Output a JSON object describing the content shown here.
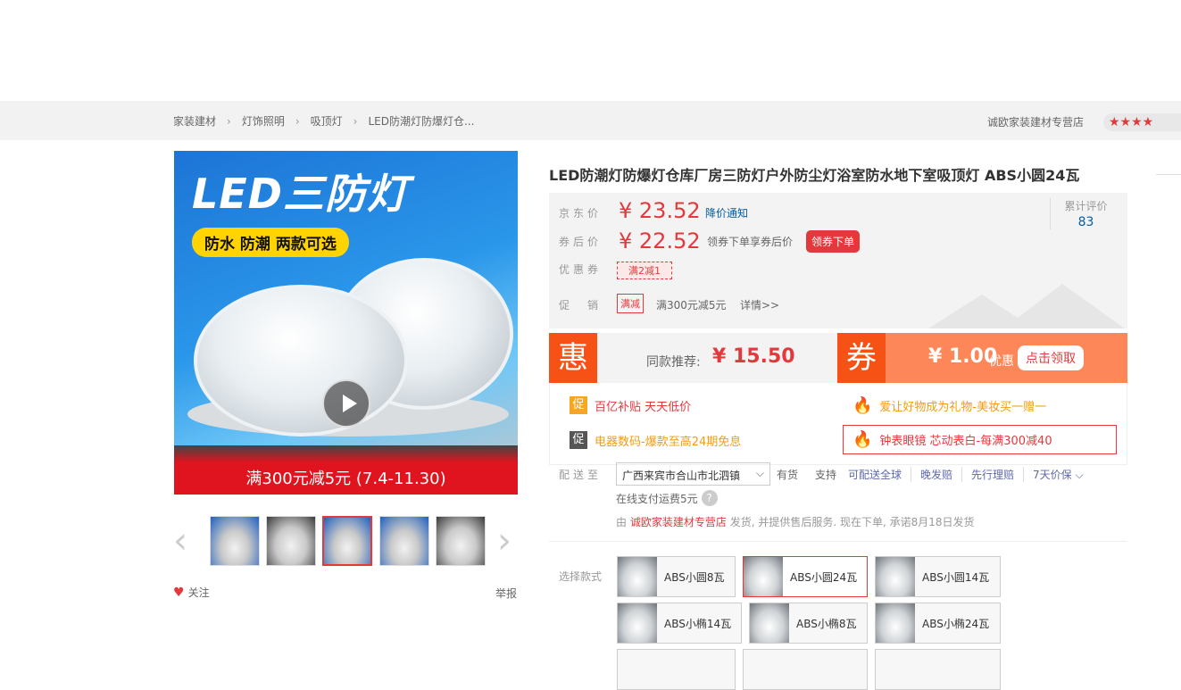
{
  "breadcrumb": [
    "家装建材",
    "灯饰照明",
    "吸顶灯",
    "LED防潮灯防爆灯仓..."
  ],
  "breadcrumb_sep": "›",
  "shop": {
    "name": "诚欧家装建材专营店",
    "stars": "★★★★"
  },
  "gallery": {
    "main_title": "LED三防灯",
    "main_subtitle": "防水 防潮 两款可选",
    "main_promo": "满300元减5元 (7.4-11.30)",
    "prev_arrow": "‹",
    "next_arrow": "›"
  },
  "follow": {
    "heart": "♥",
    "label": "关注"
  },
  "report": "举报",
  "product": {
    "title": "LED防潮灯防爆灯仓库厂房三防灯户外防尘灯浴室防水地下室吸顶灯 ABS小圆24瓦"
  },
  "price": {
    "jd_label": "京东价",
    "jd_price": "¥ 23.52",
    "notify": "降价通知",
    "after_label": "券后价",
    "after_price": "¥ 22.52",
    "after_desc": "领券下单享券后价",
    "after_button": "领券下单",
    "coupon_label": "优惠券",
    "coupon": "满2减1",
    "promo_label": "促　销",
    "promo_tag": "满减",
    "promo_text": "满300元减5元",
    "promo_detail": "详情>>",
    "review_label": "累计评价",
    "review_count": "83"
  },
  "recommend": {
    "hui": "惠",
    "label": "同款推荐:",
    "price": "¥ 15.50",
    "quan": "券",
    "coupon_amount": "¥ 1.00",
    "coupon_unit": "优惠",
    "coupon_button": "点击领取"
  },
  "activities": [
    {
      "icon": "促",
      "text": "百亿补贴 天天低价"
    },
    {
      "icon": "🔥",
      "text": "爱让好物成为礼物-美妆买一赠一"
    },
    {
      "icon": "促",
      "text": "电器数码-爆款至高24期免息"
    },
    {
      "icon": "🔥",
      "text": "钟表眼镜 芯动表白-每满300减40"
    }
  ],
  "delivery": {
    "label": "配送至",
    "address": "广西来宾市合山市北泗镇",
    "chevron": "⌵",
    "stock": "有货",
    "support_label": "支持",
    "services": [
      "可配送全球",
      "晚发赔",
      "先行理赔",
      "7天价保 ⌵"
    ],
    "fee": "在线支付运费5元",
    "fee_help": "?",
    "ship_prefix": "由",
    "ship_shop": "诚欧家装建材专营店",
    "ship_suffix": "发货, 并提供售后服务. 现在下单, 承诺8月18日发货"
  },
  "styles": {
    "label": "选择款式",
    "options": [
      "ABS小圆8瓦",
      "ABS小圆24瓦",
      "ABS小圆14瓦",
      "ABS小椭14瓦",
      "ABS小椭8瓦",
      "ABS小椭24瓦"
    ],
    "selected": "ABS小圆24瓦"
  },
  "colors": {
    "accent": "#e4393c",
    "orange": "#f65215",
    "link": "#005ea7"
  }
}
